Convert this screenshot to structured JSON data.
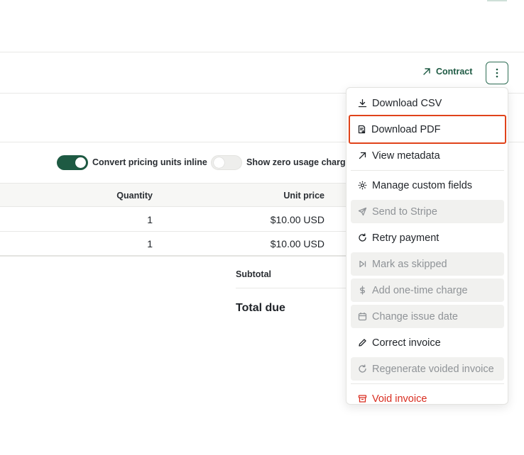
{
  "header": {
    "contract_link": "Contract",
    "more_actions": "more actions"
  },
  "toggles": [
    {
      "label": "Convert pricing units inline",
      "on": true
    },
    {
      "label": "Show zero usage charge",
      "on": false
    }
  ],
  "table": {
    "columns": [
      "Quantity",
      "Unit price"
    ],
    "rows": [
      {
        "quantity": "1",
        "unit_price": "$10.00 USD"
      },
      {
        "quantity": "1",
        "unit_price": "$10.00 USD"
      }
    ]
  },
  "summary": {
    "subtotal_label": "Subtotal",
    "total_due_label": "Total due"
  },
  "menu": {
    "items": [
      {
        "label": "Download CSV",
        "icon": "download-icon",
        "state": "normal"
      },
      {
        "label": "Download PDF",
        "icon": "file-download-icon",
        "state": "highlighted"
      },
      {
        "label": "View metadata",
        "icon": "arrow-up-right-icon",
        "state": "normal"
      },
      {
        "label": "Manage custom fields",
        "icon": "gear-icon",
        "state": "normal"
      },
      {
        "label": "Send to Stripe",
        "icon": "send-icon",
        "state": "disabled"
      },
      {
        "label": "Retry payment",
        "icon": "refresh-icon",
        "state": "normal"
      },
      {
        "label": "Mark as skipped",
        "icon": "skip-icon",
        "state": "disabled"
      },
      {
        "label": "Add one-time charge",
        "icon": "dollar-icon",
        "state": "disabled"
      },
      {
        "label": "Change issue date",
        "icon": "calendar-icon",
        "state": "disabled"
      },
      {
        "label": "Correct invoice",
        "icon": "pencil-icon",
        "state": "normal"
      },
      {
        "label": "Regenerate voided invoice",
        "icon": "refresh-icon",
        "state": "disabled"
      },
      {
        "label": "Void invoice",
        "icon": "archive-icon",
        "state": "danger"
      }
    ]
  },
  "colors": {
    "brand": "#1e5a43",
    "danger": "#d92d20",
    "highlight_outline": "#e0431a",
    "disabled_bg": "#f1f1ef"
  }
}
